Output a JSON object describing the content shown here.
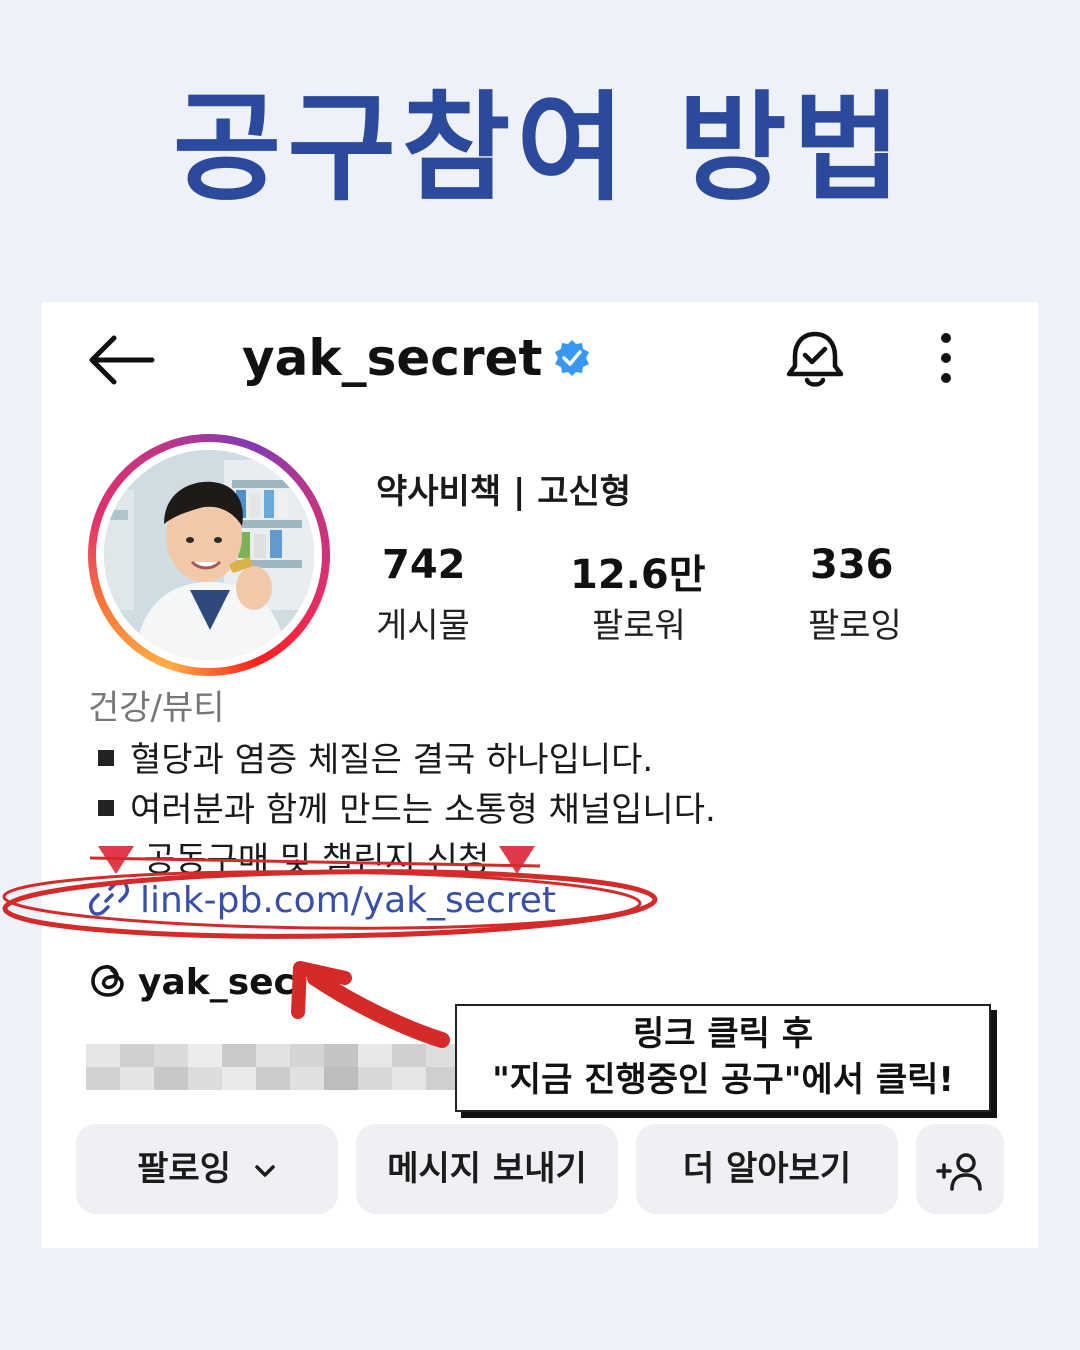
{
  "page": {
    "title": "공구참여 방법"
  },
  "profile": {
    "username": "yak_secret",
    "display_name": "약사비책 | 고신형",
    "stats": [
      {
        "value": "742",
        "label": "게시물"
      },
      {
        "value": "12.6만",
        "label": "팔로워"
      },
      {
        "value": "336",
        "label": "팔로잉"
      }
    ],
    "category": "건강/뷰티",
    "bio": [
      "혈당과 염증 체질은 결국 하나입니다.",
      "여러분과 함께 만드는 소통형 채널입니다.",
      "공동구매 및 챌린지 신청"
    ],
    "link": "link-pb.com/yak_secret",
    "threads_handle": "yak_sec"
  },
  "callout": {
    "line1": "링크 클릭 후",
    "line2": "\"지금 진행중인 공구\"에서 클릭!"
  },
  "buttons": {
    "following": "팔로잉",
    "message": "메시지 보내기",
    "learn_more": "더 알아보기"
  },
  "colors": {
    "title": "#2b4a9c",
    "link": "#3a4fa8",
    "annotation_red": "#d42a2a",
    "verified": "#3897f0"
  },
  "icons": [
    "back-arrow-icon",
    "verified-badge-icon",
    "bell-icon",
    "more-vertical-icon",
    "link-icon",
    "threads-icon",
    "chevron-down-icon",
    "add-person-icon"
  ]
}
